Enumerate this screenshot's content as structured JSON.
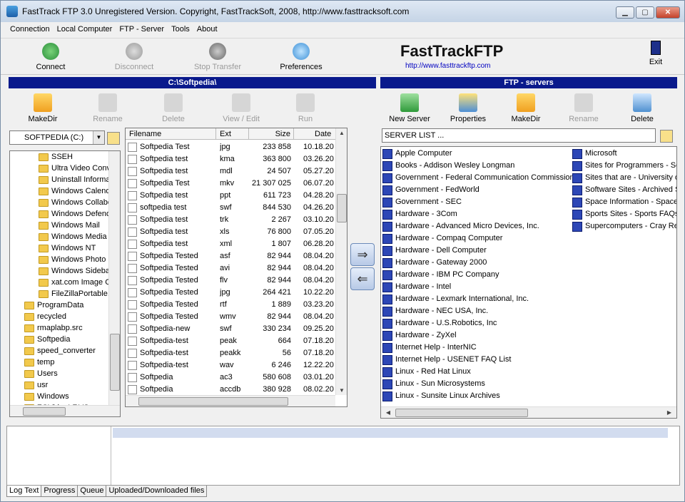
{
  "window": {
    "title": "FastTrack FTP 3.0   Unregistered Version. Copyright, FastTrackSoft, 2008, http://www.fasttracksoft.com",
    "minimize": "▁",
    "maximize": "▢",
    "close": "✕"
  },
  "menu": [
    "Connection",
    "Local Computer",
    "FTP - Server",
    "Tools",
    "About"
  ],
  "toolbar": {
    "connect": "Connect",
    "disconnect": "Disconnect",
    "stop": "Stop Transfer",
    "prefs": "Preferences",
    "exit": "Exit"
  },
  "brand": {
    "name": "FastTrackFTP",
    "url": "http://www.fasttrackftp.com"
  },
  "left": {
    "header": "C:\\Softpedia\\",
    "buttons": {
      "makedir": "MakeDir",
      "rename": "Rename",
      "delete": "Delete",
      "view": "View / Edit",
      "run": "Run"
    },
    "drive": "SOFTPEDIA (C:)",
    "tree": [
      "SSEH",
      "Ultra Video Conv",
      "Uninstall Informa",
      "Windows Calend",
      "Windows Collabo",
      "Windows Defend",
      "Windows Mail",
      "Windows Media",
      "Windows NT",
      "Windows Photo",
      "Windows Sideba",
      "xat.com Image C",
      "FileZillaPortable.",
      "ProgramData",
      "recycled",
      "rmaplabp.src",
      "Softpedia",
      "speed_converter",
      "temp",
      "Users",
      "usr",
      "Windows",
      "ZGVideoLF.VS"
    ],
    "columns": {
      "name": "Filename",
      "ext": "Ext",
      "size": "Size",
      "date": "Date"
    },
    "files": [
      {
        "name": "Softpedia Test",
        "ext": "jpg",
        "size": "233 858",
        "date": "10.18.20"
      },
      {
        "name": "Softpedia test",
        "ext": "kma",
        "size": "363 800",
        "date": "03.26.20"
      },
      {
        "name": "Softpedia test",
        "ext": "mdl",
        "size": "24 507",
        "date": "05.27.20"
      },
      {
        "name": "Softpedia Test",
        "ext": "mkv",
        "size": "21 307 025",
        "date": "06.07.20"
      },
      {
        "name": "Softpedia test",
        "ext": "ppt",
        "size": "611 723",
        "date": "04.28.20"
      },
      {
        "name": "softpedia test",
        "ext": "swf",
        "size": "844 530",
        "date": "04.26.20"
      },
      {
        "name": "Softpedia test",
        "ext": "trk",
        "size": "2 267",
        "date": "03.10.20"
      },
      {
        "name": "Softpedia test",
        "ext": "xls",
        "size": "76 800",
        "date": "07.05.20"
      },
      {
        "name": "Softpedia test",
        "ext": "xml",
        "size": "1 807",
        "date": "06.28.20"
      },
      {
        "name": "Softpedia Tested",
        "ext": "asf",
        "size": "82 944",
        "date": "08.04.20"
      },
      {
        "name": "Softpedia Tested",
        "ext": "avi",
        "size": "82 944",
        "date": "08.04.20"
      },
      {
        "name": "Softpedia Tested",
        "ext": "flv",
        "size": "82 944",
        "date": "08.04.20"
      },
      {
        "name": "Softpedia Tested",
        "ext": "jpg",
        "size": "264 421",
        "date": "10.22.20"
      },
      {
        "name": "Softpedia Tested",
        "ext": "rtf",
        "size": "1 889",
        "date": "03.23.20"
      },
      {
        "name": "Softpedia Tested",
        "ext": "wmv",
        "size": "82 944",
        "date": "08.04.20"
      },
      {
        "name": "Softpedia-new",
        "ext": "swf",
        "size": "330 234",
        "date": "09.25.20"
      },
      {
        "name": "Softpedia-test",
        "ext": "peak",
        "size": "664",
        "date": "07.18.20"
      },
      {
        "name": "Softpedia-test",
        "ext": "peakk",
        "size": "56",
        "date": "07.18.20"
      },
      {
        "name": "Softpedia-test",
        "ext": "wav",
        "size": "6 246",
        "date": "12.22.20"
      },
      {
        "name": "Softpedia",
        "ext": "ac3",
        "size": "580 608",
        "date": "03.01.20"
      },
      {
        "name": "Softpedia",
        "ext": "accdb",
        "size": "380 928",
        "date": "08.02.20"
      }
    ]
  },
  "xfer": {
    "upload": "⇒",
    "download": "⇐"
  },
  "right": {
    "header": "FTP - servers",
    "buttons": {
      "newserver": "New Server",
      "properties": "Properties",
      "makedir": "MakeDir",
      "rename": "Rename",
      "delete": "Delete"
    },
    "combo": "SERVER LIST ...",
    "col1": [
      "Apple Computer",
      "Books - Addison Wesley Longman",
      "Government - Federal Communication Commission",
      "Government - FedWorld",
      "Government - SEC",
      "Hardware - 3Com",
      "Hardware - Advanced Micro Devices, Inc.",
      "Hardware - Compaq Computer",
      "Hardware - Dell Computer",
      "Hardware - Gateway 2000",
      "Hardware - IBM PC Company",
      "Hardware - Intel",
      "Hardware - Lexmark International, Inc.",
      "Hardware - NEC USA, Inc.",
      "Hardware - U.S.Robotics, Inc",
      "Hardware - ZyXel",
      "Internet Help - InterNIC",
      "Internet Help - USENET FAQ List",
      "Linux - Red Hat Linux",
      "Linux - Sun Microsystems",
      "Linux - Sunsite Linux Archives"
    ],
    "col2": [
      "Microsoft",
      "Sites for Programmers - Soft",
      "Sites that are - University of",
      "Software Sites - Archived S",
      "Space Information - Space",
      "Sports Sites - Sports FAQs",
      "Supercomputers - Cray Res"
    ]
  },
  "tabs": [
    "Log Text",
    "Progress",
    "Queue",
    "Uploaded/Downloaded files"
  ],
  "colors": {
    "header": "#0a1a8c",
    "accent": "#0000c0"
  }
}
